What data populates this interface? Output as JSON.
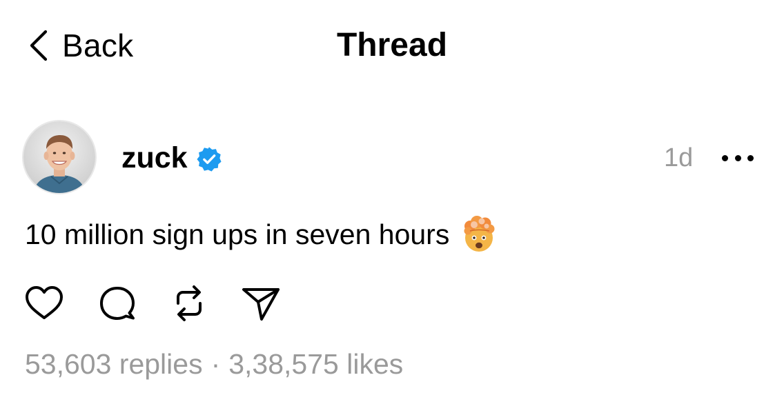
{
  "nav": {
    "back_label": "Back",
    "title": "Thread",
    "back_icon": "chevron-left-icon"
  },
  "post": {
    "author": "zuck",
    "verified": true,
    "verified_color": "#1d9bf0",
    "time": "1d",
    "more_icon": "ellipsis-icon",
    "text": "10 million sign ups in seven hours",
    "emoji": "exploding-head-emoji",
    "actions": [
      {
        "name": "like",
        "icon": "heart-icon"
      },
      {
        "name": "reply",
        "icon": "comment-icon"
      },
      {
        "name": "repost",
        "icon": "repost-icon"
      },
      {
        "name": "share",
        "icon": "send-icon"
      }
    ],
    "stats": {
      "replies": "53,603 replies",
      "separator": "·",
      "likes": "3,38,575 likes"
    }
  },
  "colors": {
    "text": "#000000",
    "secondary": "#9a9a9a",
    "background": "#ffffff"
  }
}
